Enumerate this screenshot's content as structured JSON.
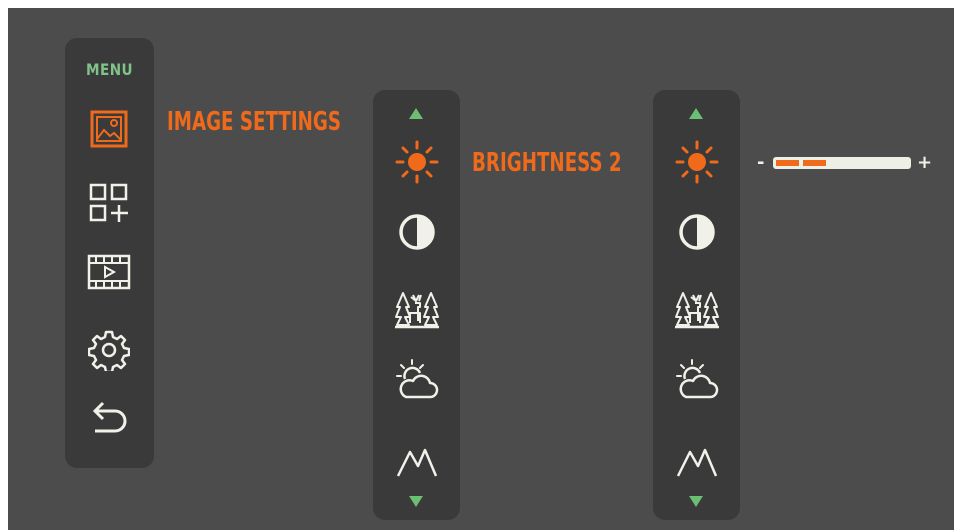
{
  "menu": {
    "title": "MENU",
    "items": [
      {
        "icon": "image-icon",
        "active": true
      },
      {
        "icon": "widgets-add-icon",
        "active": false
      },
      {
        "icon": "video-icon",
        "active": false
      },
      {
        "icon": "gear-icon",
        "active": false
      },
      {
        "icon": "back-arrow-icon",
        "active": false
      }
    ]
  },
  "submenu": {
    "heading": "IMAGE SETTINGS",
    "items": [
      "sun-icon",
      "contrast-icon",
      "forest-deer-icon",
      "sun-cloud-icon",
      "mountain-icon"
    ]
  },
  "settings": {
    "heading": "BRIGHTNESS 2",
    "items": [
      "sun-icon",
      "contrast-icon",
      "forest-deer-icon",
      "sun-cloud-icon",
      "mountain-icon"
    ]
  },
  "slider": {
    "minus": "-",
    "plus": "+",
    "level": 2,
    "max": 5
  },
  "colors": {
    "accent": "#ef6a1a",
    "menu_title": "#7fc28a",
    "arrows": "#6bbf73",
    "icon": "#f1f1ea",
    "panel": "#3a3a3a",
    "background": "#4c4c4c"
  }
}
